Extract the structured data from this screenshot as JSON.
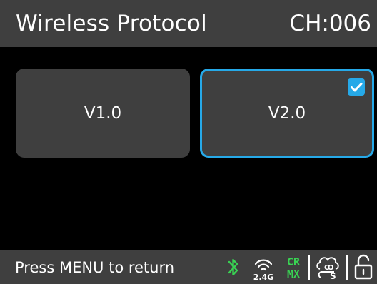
{
  "header": {
    "title": "Wireless Protocol",
    "channel": "CH:006"
  },
  "options": [
    {
      "label": "V1.0",
      "selected": false
    },
    {
      "label": "V2.0",
      "selected": true
    }
  ],
  "footer": {
    "hint": "Press MENU to return",
    "status_icons": {
      "bluetooth": {
        "icon": "bluetooth-icon",
        "color": "#39d353"
      },
      "wireless": {
        "icon": "wireless-2.4g-icon",
        "label": "2.4G",
        "color": "#ffffff"
      },
      "crmx": {
        "icon": "crmx-icon",
        "line1": "CR",
        "line2": "MX",
        "color": "#39d353"
      },
      "dmx": {
        "icon": "cos-icon",
        "label": "COS",
        "color": "#ffffff"
      },
      "lock": {
        "icon": "unlocked-icon",
        "color": "#ffffff"
      }
    }
  },
  "colors": {
    "background": "#000000",
    "panel": "#3f3f3f",
    "accent": "#26a9e8",
    "active_green": "#39d353"
  }
}
